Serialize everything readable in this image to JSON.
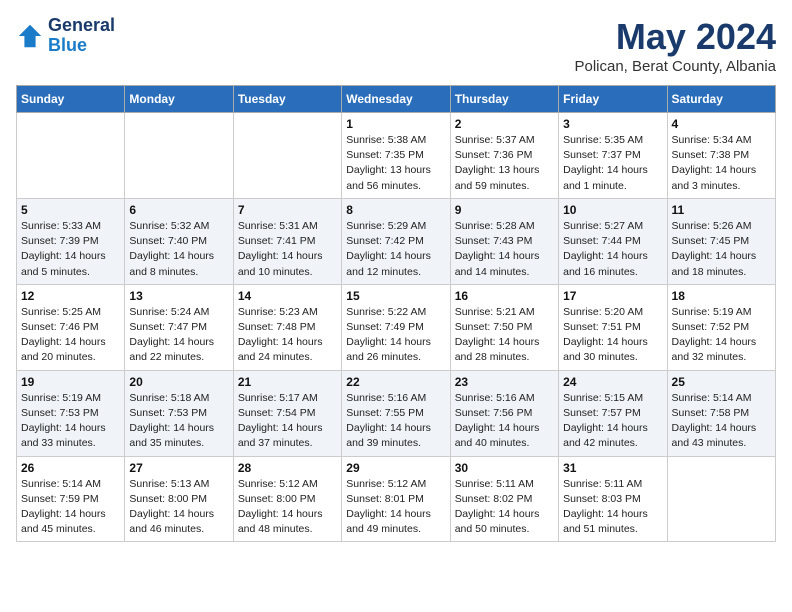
{
  "logo": {
    "line1": "General",
    "line2": "Blue"
  },
  "title": "May 2024",
  "location": "Polican, Berat County, Albania",
  "days_of_week": [
    "Sunday",
    "Monday",
    "Tuesday",
    "Wednesday",
    "Thursday",
    "Friday",
    "Saturday"
  ],
  "weeks": [
    [
      {
        "day": "",
        "info": ""
      },
      {
        "day": "",
        "info": ""
      },
      {
        "day": "",
        "info": ""
      },
      {
        "day": "1",
        "info": "Sunrise: 5:38 AM\nSunset: 7:35 PM\nDaylight: 13 hours\nand 56 minutes."
      },
      {
        "day": "2",
        "info": "Sunrise: 5:37 AM\nSunset: 7:36 PM\nDaylight: 13 hours\nand 59 minutes."
      },
      {
        "day": "3",
        "info": "Sunrise: 5:35 AM\nSunset: 7:37 PM\nDaylight: 14 hours\nand 1 minute."
      },
      {
        "day": "4",
        "info": "Sunrise: 5:34 AM\nSunset: 7:38 PM\nDaylight: 14 hours\nand 3 minutes."
      }
    ],
    [
      {
        "day": "5",
        "info": "Sunrise: 5:33 AM\nSunset: 7:39 PM\nDaylight: 14 hours\nand 5 minutes."
      },
      {
        "day": "6",
        "info": "Sunrise: 5:32 AM\nSunset: 7:40 PM\nDaylight: 14 hours\nand 8 minutes."
      },
      {
        "day": "7",
        "info": "Sunrise: 5:31 AM\nSunset: 7:41 PM\nDaylight: 14 hours\nand 10 minutes."
      },
      {
        "day": "8",
        "info": "Sunrise: 5:29 AM\nSunset: 7:42 PM\nDaylight: 14 hours\nand 12 minutes."
      },
      {
        "day": "9",
        "info": "Sunrise: 5:28 AM\nSunset: 7:43 PM\nDaylight: 14 hours\nand 14 minutes."
      },
      {
        "day": "10",
        "info": "Sunrise: 5:27 AM\nSunset: 7:44 PM\nDaylight: 14 hours\nand 16 minutes."
      },
      {
        "day": "11",
        "info": "Sunrise: 5:26 AM\nSunset: 7:45 PM\nDaylight: 14 hours\nand 18 minutes."
      }
    ],
    [
      {
        "day": "12",
        "info": "Sunrise: 5:25 AM\nSunset: 7:46 PM\nDaylight: 14 hours\nand 20 minutes."
      },
      {
        "day": "13",
        "info": "Sunrise: 5:24 AM\nSunset: 7:47 PM\nDaylight: 14 hours\nand 22 minutes."
      },
      {
        "day": "14",
        "info": "Sunrise: 5:23 AM\nSunset: 7:48 PM\nDaylight: 14 hours\nand 24 minutes."
      },
      {
        "day": "15",
        "info": "Sunrise: 5:22 AM\nSunset: 7:49 PM\nDaylight: 14 hours\nand 26 minutes."
      },
      {
        "day": "16",
        "info": "Sunrise: 5:21 AM\nSunset: 7:50 PM\nDaylight: 14 hours\nand 28 minutes."
      },
      {
        "day": "17",
        "info": "Sunrise: 5:20 AM\nSunset: 7:51 PM\nDaylight: 14 hours\nand 30 minutes."
      },
      {
        "day": "18",
        "info": "Sunrise: 5:19 AM\nSunset: 7:52 PM\nDaylight: 14 hours\nand 32 minutes."
      }
    ],
    [
      {
        "day": "19",
        "info": "Sunrise: 5:19 AM\nSunset: 7:53 PM\nDaylight: 14 hours\nand 33 minutes."
      },
      {
        "day": "20",
        "info": "Sunrise: 5:18 AM\nSunset: 7:53 PM\nDaylight: 14 hours\nand 35 minutes."
      },
      {
        "day": "21",
        "info": "Sunrise: 5:17 AM\nSunset: 7:54 PM\nDaylight: 14 hours\nand 37 minutes."
      },
      {
        "day": "22",
        "info": "Sunrise: 5:16 AM\nSunset: 7:55 PM\nDaylight: 14 hours\nand 39 minutes."
      },
      {
        "day": "23",
        "info": "Sunrise: 5:16 AM\nSunset: 7:56 PM\nDaylight: 14 hours\nand 40 minutes."
      },
      {
        "day": "24",
        "info": "Sunrise: 5:15 AM\nSunset: 7:57 PM\nDaylight: 14 hours\nand 42 minutes."
      },
      {
        "day": "25",
        "info": "Sunrise: 5:14 AM\nSunset: 7:58 PM\nDaylight: 14 hours\nand 43 minutes."
      }
    ],
    [
      {
        "day": "26",
        "info": "Sunrise: 5:14 AM\nSunset: 7:59 PM\nDaylight: 14 hours\nand 45 minutes."
      },
      {
        "day": "27",
        "info": "Sunrise: 5:13 AM\nSunset: 8:00 PM\nDaylight: 14 hours\nand 46 minutes."
      },
      {
        "day": "28",
        "info": "Sunrise: 5:12 AM\nSunset: 8:00 PM\nDaylight: 14 hours\nand 48 minutes."
      },
      {
        "day": "29",
        "info": "Sunrise: 5:12 AM\nSunset: 8:01 PM\nDaylight: 14 hours\nand 49 minutes."
      },
      {
        "day": "30",
        "info": "Sunrise: 5:11 AM\nSunset: 8:02 PM\nDaylight: 14 hours\nand 50 minutes."
      },
      {
        "day": "31",
        "info": "Sunrise: 5:11 AM\nSunset: 8:03 PM\nDaylight: 14 hours\nand 51 minutes."
      },
      {
        "day": "",
        "info": ""
      }
    ]
  ]
}
